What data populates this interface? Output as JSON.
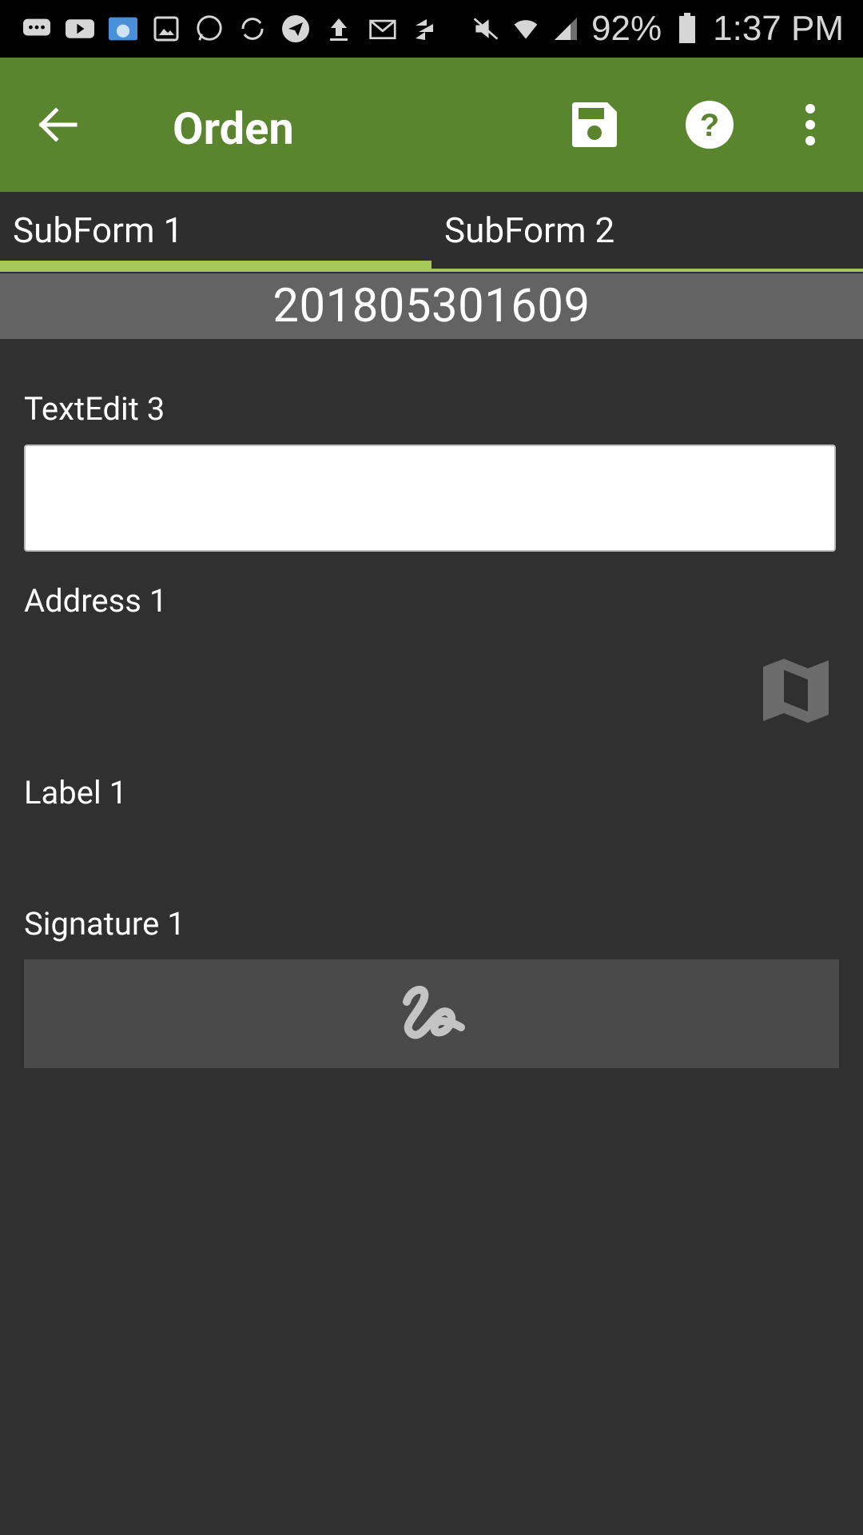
{
  "status_bar": {
    "battery": "92%",
    "time": "1:37 PM",
    "icons_left": [
      "message-icon",
      "youtube-icon",
      "file-manager-icon",
      "gallery-icon",
      "whatsapp-icon",
      "sync-icon",
      "telegram-icon",
      "upload-icon",
      "gmail-icon",
      "app-icon"
    ],
    "icons_right": [
      "mute-icon",
      "wifi-icon",
      "signal-icon",
      "battery-icon"
    ]
  },
  "app_bar": {
    "title": "Orden",
    "color": "#5b842e",
    "actions": [
      "save-icon",
      "help-icon",
      "more-vert-icon"
    ]
  },
  "tabs": [
    {
      "label": "SubForm 1",
      "active": true
    },
    {
      "label": "SubForm 2",
      "active": false
    }
  ],
  "tab_accent_color": "#a6c85a",
  "banner": {
    "text": "201805301609"
  },
  "form": {
    "textedit": {
      "label": "TextEdit 3",
      "value": "",
      "placeholder": ""
    },
    "address": {
      "label": "Address 1"
    },
    "label_field": {
      "label": "Label 1"
    },
    "signature": {
      "label": "Signature 1"
    }
  }
}
